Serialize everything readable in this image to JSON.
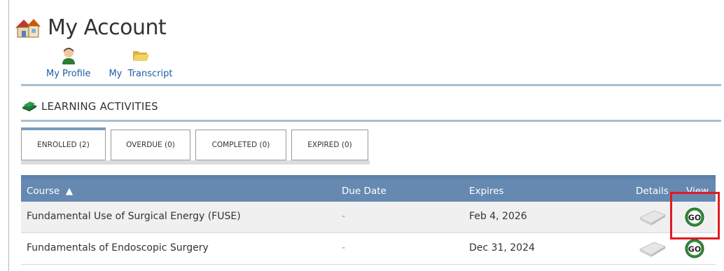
{
  "header": {
    "title": "My Account"
  },
  "quicklinks": [
    {
      "label": "My Profile",
      "icon": "profile-icon"
    },
    {
      "label": "My  Transcript",
      "icon": "folder-icon"
    }
  ],
  "section": {
    "title": "LEARNING ACTIVITIES",
    "icon": "books-icon"
  },
  "tabs": [
    {
      "label": "ENROLLED (2)",
      "active": true
    },
    {
      "label": "OVERDUE (0)",
      "active": false
    },
    {
      "label": "COMPLETED (0)",
      "active": false
    },
    {
      "label": "EXPIRED (0)",
      "active": false
    }
  ],
  "table": {
    "headers": {
      "course": "Course  ▲",
      "due": "Due Date",
      "expires": "Expires",
      "details": "Details",
      "view": "View"
    },
    "rows": [
      {
        "course": "Fundamental Use of Surgical Energy (FUSE)",
        "due": "-",
        "expires": "Feb 4, 2026"
      },
      {
        "course": "Fundamentals of Endoscopic Surgery",
        "due": "-",
        "expires": "Dec 31, 2024"
      }
    ]
  },
  "colors": {
    "header_bg": "#6589b1",
    "link": "#1e5ca8",
    "highlight": "#e11b22",
    "go_green": "#2e8b3a"
  }
}
